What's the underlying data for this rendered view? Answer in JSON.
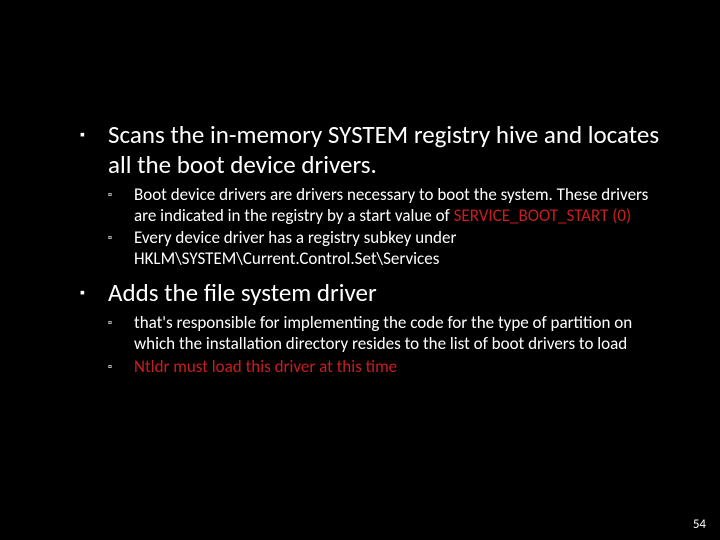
{
  "slide": {
    "items": [
      {
        "text": "Scans the in-memory SYSTEM registry hive and locates all the boot device drivers.",
        "sub": [
          {
            "prefix": "Boot device drivers are drivers necessary to boot the system. These drivers are indicated in the registry by a start value of ",
            "red": "SERVICE_BOOT_START (0)",
            "suffix": ""
          },
          {
            "prefix": "Every device driver has a registry subkey under HKLM\\SYSTEM\\Current.Control.Set\\Services",
            "red": "",
            "suffix": ""
          }
        ]
      },
      {
        "text": "Adds the file system driver",
        "sub": [
          {
            "prefix": "that's responsible for implementing the code for the type of partition on which the installation directory resides to the list of boot drivers to load",
            "red": "",
            "suffix": ""
          },
          {
            "prefix": "",
            "red": "Ntldr must load this driver at this time",
            "suffix": ""
          }
        ]
      }
    ],
    "page_number": "54"
  }
}
